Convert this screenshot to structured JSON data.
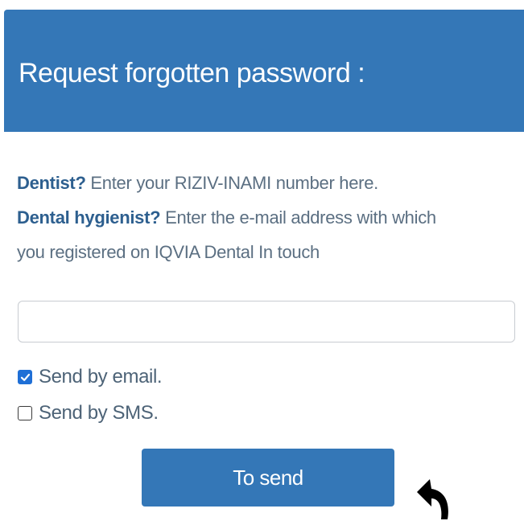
{
  "header": {
    "title": "Request forgotten password :"
  },
  "instructions": {
    "dentist_label": "Dentist?",
    "dentist_text": " Enter your RIZIV-INAMI number here.",
    "hygienist_label": "Dental hygienist?",
    "hygienist_text": " Enter the e-mail address with which",
    "hygienist_text_cont": "you registered on IQVIA Dental In touch"
  },
  "identifier_input": {
    "value": "",
    "placeholder": ""
  },
  "options": {
    "email_label": "Send by email.",
    "email_checked": true,
    "sms_label": "Send by SMS.",
    "sms_checked": false
  },
  "submit": {
    "label": "To send"
  },
  "colors": {
    "header_bg": "#3477b7",
    "button_bg": "#3477b7",
    "checkbox_checked": "#1f6fd6",
    "label_strong": "#2d5f8f",
    "text_muted": "#5b6f82"
  },
  "icons": {
    "cursor": "curved-arrow-icon",
    "checkmark": "checkmark-icon"
  }
}
